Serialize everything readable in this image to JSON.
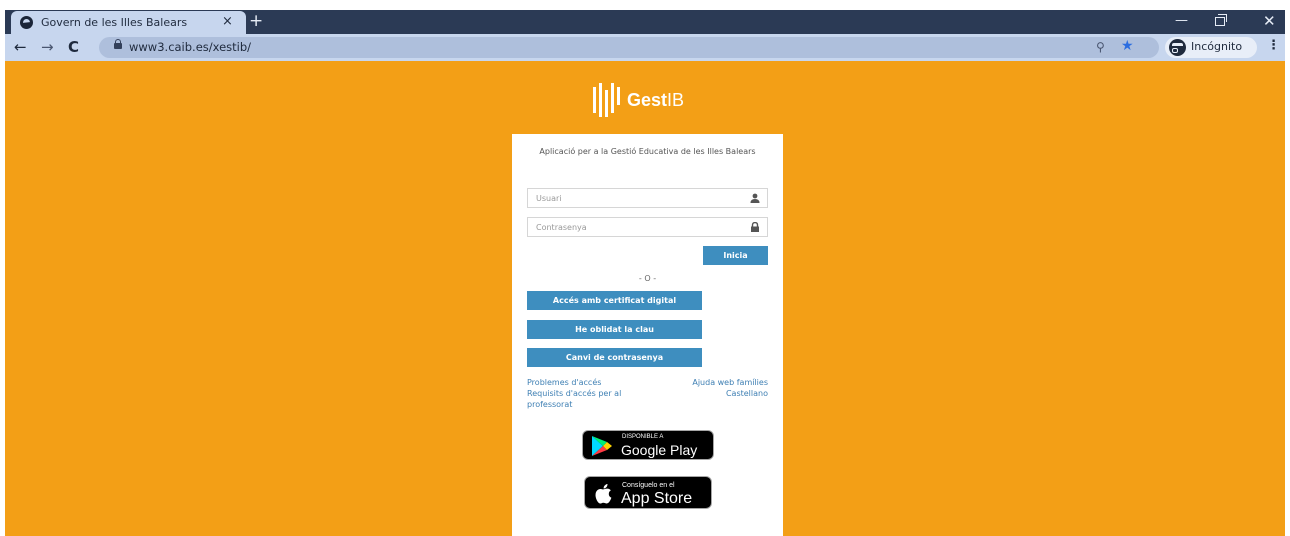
{
  "browser": {
    "tab_title": "Govern de les Illes Balears",
    "tab_close": "×",
    "new_tab": "+",
    "url": "www3.caib.es/xestib/",
    "incognito_label": "Incógnito"
  },
  "brand": {
    "name_bold": "Gest",
    "name_light": "IB"
  },
  "login": {
    "subtitle": "Aplicació per a la Gestió Educativa de les Illes Balears",
    "user_placeholder": "Usuari",
    "user_value": "",
    "password_placeholder": "Contrasenya",
    "password_value": "",
    "login_button": "Inicia",
    "or_separator": "- O -",
    "cert_button": "Accés amb certificat digital",
    "forgot_button": "He oblidat la clau",
    "change_password_button": "Canvi de contrasenya"
  },
  "links": {
    "access_problems": "Problemes d'accés",
    "teacher_requirements": "Requisits d'accés per al professorat",
    "family_help": "Ajuda web famílies",
    "castellano": "Castellano"
  },
  "stores": {
    "google_small": "DISPONIBLE A",
    "google_big": "Google Play",
    "apple_small": "Consíguelo en el",
    "apple_big": "App Store"
  },
  "colors": {
    "page_background": "#f39f16",
    "button": "#3e8ebf",
    "link": "#3e7fb3"
  },
  "icons": [
    "globe-icon",
    "close-icon",
    "plus-icon",
    "minimize-icon",
    "restore-icon",
    "back-arrow-icon",
    "forward-arrow-icon",
    "reload-icon",
    "lock-icon",
    "zoom-icon",
    "star-icon",
    "incognito-icon",
    "menu-dots-icon",
    "user-icon",
    "padlock-icon",
    "google-play-icon",
    "apple-icon"
  ]
}
